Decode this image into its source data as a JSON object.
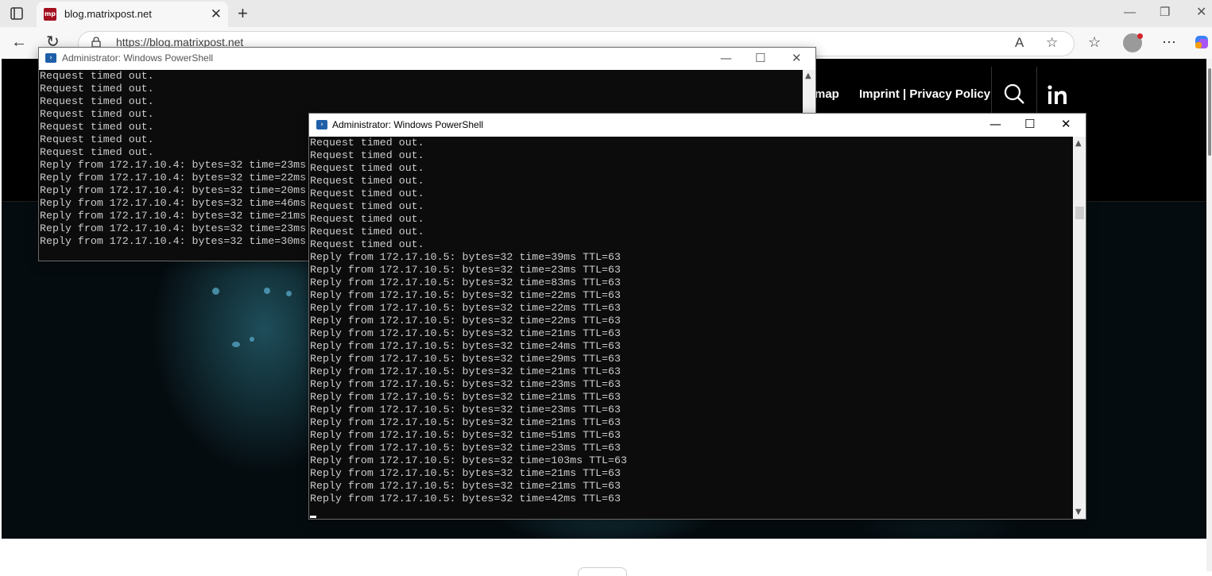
{
  "browser": {
    "tab_title": "blog.matrixpost.net",
    "favicon_text": "mp",
    "url": "https://blog.matrixpost.net",
    "icons": {
      "tab_actions": "tab-actions-icon",
      "close": "close-icon",
      "new_tab": "plus-icon",
      "back": "back-arrow-icon",
      "refresh": "refresh-icon",
      "lock": "lock-icon",
      "read_aloud": "read-aloud-icon",
      "favorite": "star-icon",
      "favorites": "favorites-icon",
      "profile": "profile-avatar",
      "menu": "more-icon",
      "copilot": "copilot-icon"
    }
  },
  "site": {
    "nav_partial": "map",
    "nav_imprint": "Imprint | Privacy Policy",
    "icons": {
      "search": "search-icon",
      "linkedin": "linkedin-icon"
    },
    "colors": {
      "header_bg": "#000000",
      "brand_red": "#a30f1f"
    }
  },
  "ps_back": {
    "title": "Administrator: Windows PowerShell",
    "lines": [
      "Request timed out.",
      "Request timed out.",
      "Request timed out.",
      "Request timed out.",
      "Request timed out.",
      "Request timed out.",
      "Request timed out.",
      "Reply from 172.17.10.4: bytes=32 time=23ms",
      "Reply from 172.17.10.4: bytes=32 time=22ms",
      "Reply from 172.17.10.4: bytes=32 time=20ms",
      "Reply from 172.17.10.4: bytes=32 time=46ms",
      "Reply from 172.17.10.4: bytes=32 time=21ms",
      "Reply from 172.17.10.4: bytes=32 time=23ms",
      "Reply from 172.17.10.4: bytes=32 time=30ms"
    ]
  },
  "ps_front": {
    "title": "Administrator: Windows PowerShell",
    "lines": [
      "Request timed out.",
      "Request timed out.",
      "Request timed out.",
      "Request timed out.",
      "Request timed out.",
      "Request timed out.",
      "Request timed out.",
      "Request timed out.",
      "Request timed out.",
      "Reply from 172.17.10.5: bytes=32 time=39ms TTL=63",
      "Reply from 172.17.10.5: bytes=32 time=23ms TTL=63",
      "Reply from 172.17.10.5: bytes=32 time=83ms TTL=63",
      "Reply from 172.17.10.5: bytes=32 time=22ms TTL=63",
      "Reply from 172.17.10.5: bytes=32 time=22ms TTL=63",
      "Reply from 172.17.10.5: bytes=32 time=22ms TTL=63",
      "Reply from 172.17.10.5: bytes=32 time=21ms TTL=63",
      "Reply from 172.17.10.5: bytes=32 time=24ms TTL=63",
      "Reply from 172.17.10.5: bytes=32 time=29ms TTL=63",
      "Reply from 172.17.10.5: bytes=32 time=21ms TTL=63",
      "Reply from 172.17.10.5: bytes=32 time=23ms TTL=63",
      "Reply from 172.17.10.5: bytes=32 time=21ms TTL=63",
      "Reply from 172.17.10.5: bytes=32 time=23ms TTL=63",
      "Reply from 172.17.10.5: bytes=32 time=21ms TTL=63",
      "Reply from 172.17.10.5: bytes=32 time=51ms TTL=63",
      "Reply from 172.17.10.5: bytes=32 time=23ms TTL=63",
      "Reply from 172.17.10.5: bytes=32 time=103ms TTL=63",
      "Reply from 172.17.10.5: bytes=32 time=21ms TTL=63",
      "Reply from 172.17.10.5: bytes=32 time=21ms TTL=63",
      "Reply from 172.17.10.5: bytes=32 time=42ms TTL=63"
    ]
  },
  "colors": {
    "console_bg": "#0c0c0c",
    "console_text": "#cccccc",
    "powershell_icon": "#1f5fa8"
  }
}
